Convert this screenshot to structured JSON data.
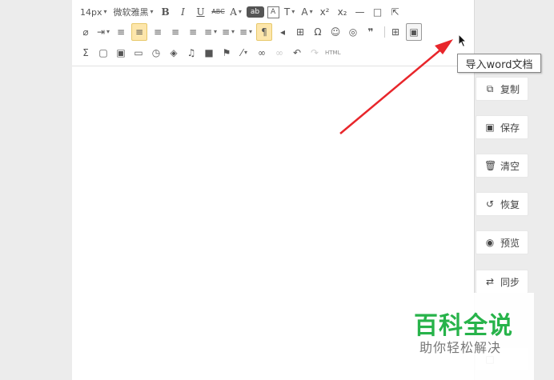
{
  "toolbar": {
    "font_size": "14px",
    "font_family": "微软雅黑",
    "row1": [
      "B",
      "I",
      "U",
      "ABC",
      "A",
      "ab",
      "A",
      "T",
      "A",
      "x²",
      "x₂",
      "—",
      "□",
      "⇱"
    ],
    "row2": [
      "⌀",
      "⇥",
      "≡",
      "≡",
      "≡",
      "≡",
      "≡",
      "≡",
      "≡",
      "¶",
      "◂",
      "⊞",
      "Ω",
      "☺",
      "◎",
      "❞",
      "⊞",
      "▣"
    ],
    "row3": [
      "Σ",
      "▢",
      "▣",
      "▭",
      "◷",
      "◈",
      "♫",
      "■",
      "⚑",
      "⁄",
      "∞",
      "∞",
      "↶",
      "↷",
      "HTML"
    ],
    "html_label": "HTML"
  },
  "tooltip": {
    "text": "导入word文档"
  },
  "sidebar": {
    "copy": "复制",
    "save": "保存",
    "clear": "清空",
    "restore": "恢复",
    "preview": "预览",
    "sync": "同步"
  },
  "watermark": {
    "title": "百科全说",
    "subtitle": "助你轻松解决"
  },
  "colors": {
    "arrow": "#e8262b",
    "watermark_green": "#27b34a",
    "active_button": "#fde6ab"
  }
}
